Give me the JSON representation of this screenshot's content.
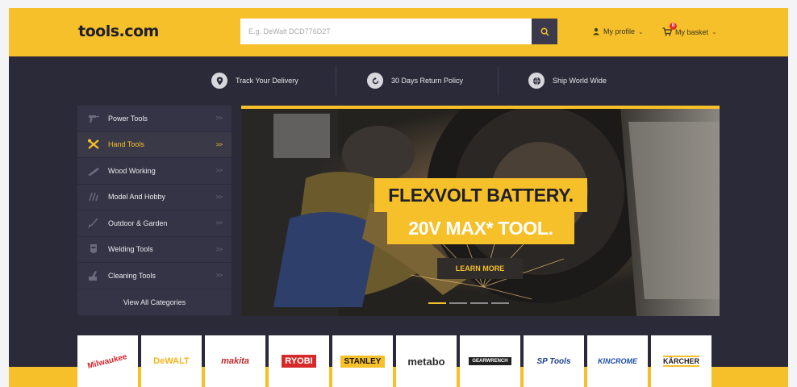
{
  "header": {
    "logo": "tools.com",
    "search_placeholder": "E.g. DeWalt DCD776D2T",
    "profile_label": "My profile",
    "basket_label": "My basket",
    "basket_count": "0"
  },
  "features": [
    {
      "label": "Track Your Delivery",
      "icon": "location-pin-icon"
    },
    {
      "label": "30 Days Return Policy",
      "icon": "return-arrow-icon"
    },
    {
      "label": "Ship World Wide",
      "icon": "globe-icon"
    }
  ],
  "sidebar": {
    "items": [
      {
        "label": "Power Tools",
        "icon": "drill-icon",
        "arrow": ">>"
      },
      {
        "label": "Hand Tools",
        "icon": "crossed-tools-icon",
        "arrow": ">>"
      },
      {
        "label": "Wood Working",
        "icon": "saw-icon",
        "arrow": ">>"
      },
      {
        "label": "Model And Hobby",
        "icon": "hobby-knife-icon",
        "arrow": ">>"
      },
      {
        "label": "Outdoor & Garden",
        "icon": "garden-tool-icon",
        "arrow": ">>"
      },
      {
        "label": "Welding Tools",
        "icon": "welding-mask-icon",
        "arrow": ">>"
      },
      {
        "label": "Cleaning Tools",
        "icon": "cleaning-brush-icon",
        "arrow": ">>"
      }
    ],
    "view_all": "View All Categories",
    "active_index": 1
  },
  "banner": {
    "headline_1": "FLEXVOLT BATTERY.",
    "headline_2": "20V MAX* TOOL.",
    "cta": "LEARN MORE",
    "slides": 4,
    "active_slide": 0
  },
  "brands": [
    {
      "name": "Milwaukee",
      "color": "#d6262e"
    },
    {
      "name": "DeWALT",
      "color": "#f2b51a"
    },
    {
      "name": "makita",
      "color": "#1f8fa8"
    },
    {
      "name": "RYOBI",
      "color": "#ffffff"
    },
    {
      "name": "STANLEY",
      "color": "#111111"
    },
    {
      "name": "metabo",
      "color": "#2b2b2b"
    },
    {
      "name": "GEARWRENCH",
      "color": "#ffffff"
    },
    {
      "name": "SP Tools",
      "color": "#1b3f8f"
    },
    {
      "name": "KINCROME",
      "color": "#1a4aa8"
    },
    {
      "name": "KÄRCHER",
      "color": "#1a1a1a"
    }
  ],
  "colors": {
    "accent": "#f6c02a",
    "dark_bg": "#2b2a39",
    "sidebar_bg": "#353446"
  }
}
